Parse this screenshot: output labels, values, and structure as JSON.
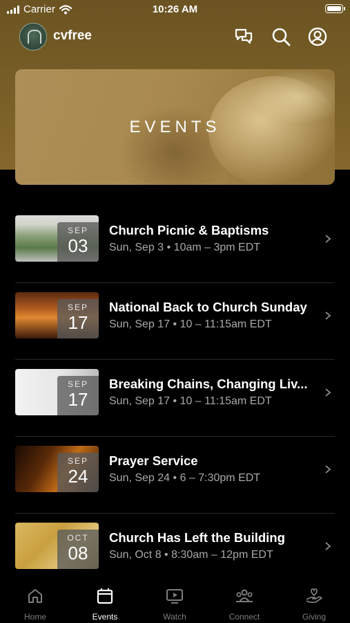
{
  "status_bar": {
    "carrier": "Carrier",
    "time": "10:26 AM"
  },
  "header": {
    "app_name": "cvfree",
    "icons": [
      "chat-icon",
      "search-icon",
      "profile-icon"
    ]
  },
  "banner": {
    "title": "EVENTS"
  },
  "events": [
    {
      "title": "Church Picnic & Baptisms",
      "time": "Sun, Sep 3 • 10am – 3pm EDT",
      "month": "SEP",
      "day": "03"
    },
    {
      "title": "National Back to Church Sunday",
      "time": "Sun, Sep 17 • 10 – 11:15am EDT",
      "month": "SEP",
      "day": "17"
    },
    {
      "title": "Breaking Chains, Changing Liv...",
      "time": "Sun, Sep 17 • 10 – 11:15am EDT",
      "month": "SEP",
      "day": "17"
    },
    {
      "title": "Prayer Service",
      "time": "Sun, Sep 24 • 6 – 7:30pm EDT",
      "month": "SEP",
      "day": "24"
    },
    {
      "title": "Church Has Left the Building",
      "time": "Sun, Oct 8 • 8:30am – 12pm EDT",
      "month": "OCT",
      "day": "08"
    }
  ],
  "tabs": [
    {
      "label": "Home",
      "icon": "home-icon",
      "active": false
    },
    {
      "label": "Events",
      "icon": "calendar-icon",
      "active": true
    },
    {
      "label": "Watch",
      "icon": "video-icon",
      "active": false
    },
    {
      "label": "Connect",
      "icon": "people-icon",
      "active": false
    },
    {
      "label": "Giving",
      "icon": "giving-icon",
      "active": false
    }
  ],
  "colors": {
    "header_bg": "#7a5f27",
    "background": "#000000",
    "secondary_text": "#a9a9a9"
  }
}
